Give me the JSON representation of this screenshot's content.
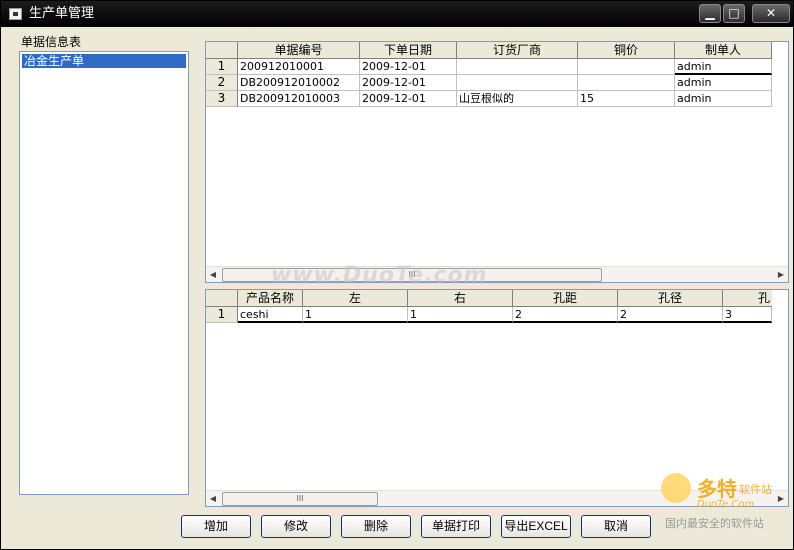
{
  "window": {
    "title": "生产单管理"
  },
  "sidebar": {
    "label": "单据信息表",
    "items": [
      {
        "label": "冶金生产单"
      }
    ]
  },
  "top_grid": {
    "columns": [
      "单据编号",
      "下单日期",
      "订货厂商",
      "铜价",
      "制单人"
    ],
    "rows": [
      {
        "no": "1",
        "cells": [
          "200912010001",
          "2009-12-01",
          "",
          "",
          "admin"
        ]
      },
      {
        "no": "2",
        "cells": [
          "DB200912010002",
          "2009-12-01",
          "",
          "",
          "admin"
        ]
      },
      {
        "no": "3",
        "cells": [
          "DB200912010003",
          "2009-12-01",
          "山豆根似的",
          "15",
          "admin"
        ]
      }
    ]
  },
  "bottom_grid": {
    "columns": [
      "产品名称",
      "左",
      "右",
      "孔距",
      "孔径",
      "孔"
    ],
    "rows": [
      {
        "no": "1",
        "cells": [
          "ceshi",
          "1",
          "1",
          "2",
          "2",
          "3"
        ]
      }
    ]
  },
  "buttons": {
    "add": "增加",
    "edit": "修改",
    "delete": "删除",
    "print": "单据打印",
    "export": "导出EXCEL",
    "cancel": "取消"
  },
  "scroll_thumb": "III",
  "watermark": {
    "text": "www.DuoTe.com",
    "logo_main": "多特",
    "logo_sub": "软件站",
    "logo_url": "DuoTe.Com",
    "logo_tag": "国内最安全的软件站"
  }
}
